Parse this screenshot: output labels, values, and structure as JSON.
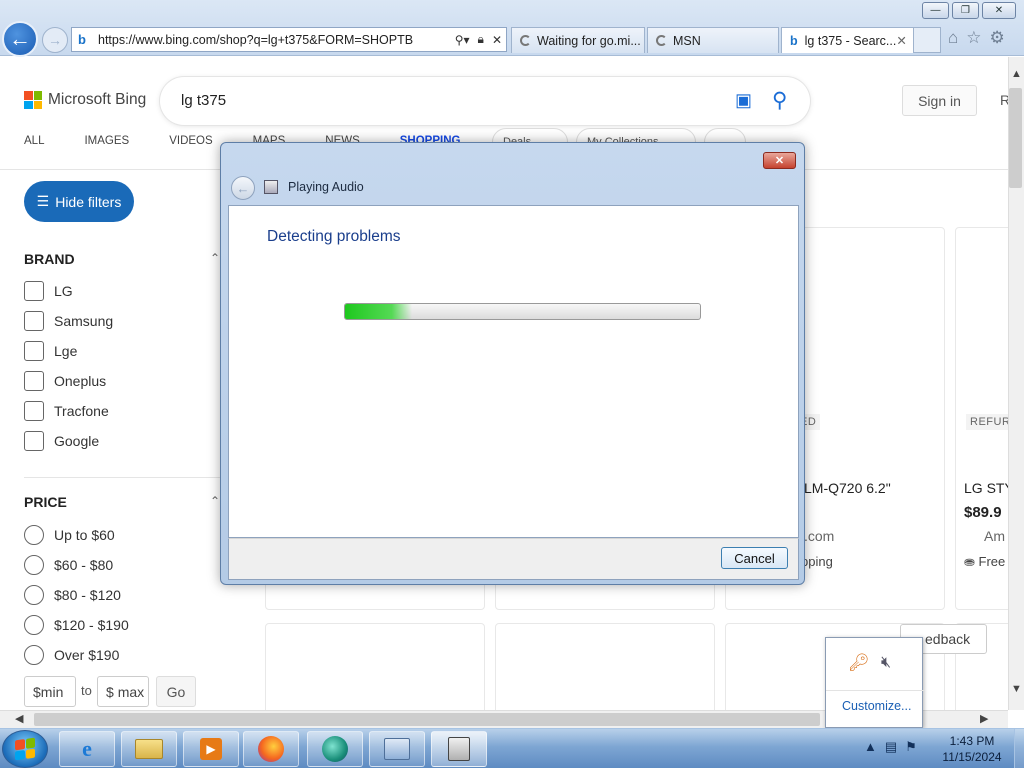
{
  "browser": {
    "address_url": "https://www.bing.com/shop?q=lg+t375&FORM=SHOPTB",
    "tabs": [
      {
        "label": "Waiting for go.mi...",
        "icon": "loading-spinner"
      },
      {
        "label": "MSN",
        "icon": "loading-spinner"
      },
      {
        "label": "lg t375 - Searc...",
        "icon": "bing-icon",
        "active": true
      }
    ],
    "window_buttons": [
      "minimize",
      "restore",
      "close"
    ],
    "toolbar_icons": [
      "home-icon",
      "star-icon",
      "gear-icon"
    ]
  },
  "page": {
    "brand": "Microsoft Bing",
    "search_query": "lg t375",
    "sign_in": "Sign in",
    "rewards_initial": "R",
    "scopes": [
      "ALL",
      "IMAGES",
      "VIDEOS",
      "MAPS",
      "NEWS",
      "SHOPPING"
    ],
    "pills": [
      "Deals",
      "My Collections"
    ],
    "hide_filters": "Hide filters",
    "brand_filter": {
      "title": "BRAND",
      "options": [
        "LG",
        "Samsung",
        "Lge",
        "Oneplus",
        "Tracfone",
        "Google"
      ]
    },
    "price_filter": {
      "title": "PRICE",
      "options": [
        "Up to $60",
        "$60 - $80",
        "$80 - $120",
        "$120 - $190",
        "Over $190"
      ],
      "min_placeholder": "min",
      "max_placeholder": "max",
      "currency": "$",
      "to_label": "to",
      "go_label": "Go"
    },
    "products": [
      {
        "badge": "ED",
        "title": "LM-Q720 6.2\"",
        "store": ".com",
        "shipping": "pping"
      },
      {
        "badge": "REFUR",
        "title": "LG STY",
        "price": "$89.9",
        "store": "Am",
        "shipping": "Free"
      }
    ],
    "feedback": "edback"
  },
  "dialog": {
    "title": "Playing Audio",
    "heading": "Detecting problems",
    "progress": 0.19,
    "cancel": "Cancel"
  },
  "tray_popup": {
    "customize": "Customize..."
  },
  "taskbar": {
    "apps": [
      "internet-explorer",
      "file-explorer",
      "media-player",
      "firefox",
      "edge-app",
      "control-panel",
      "troubleshooter"
    ],
    "time": "1:43 PM",
    "date": "11/15/2024"
  },
  "colors": {
    "bing_blue": "#1a6ab8",
    "dialog_heading": "#1a3e8c",
    "progress_green": "#1ec81e"
  }
}
